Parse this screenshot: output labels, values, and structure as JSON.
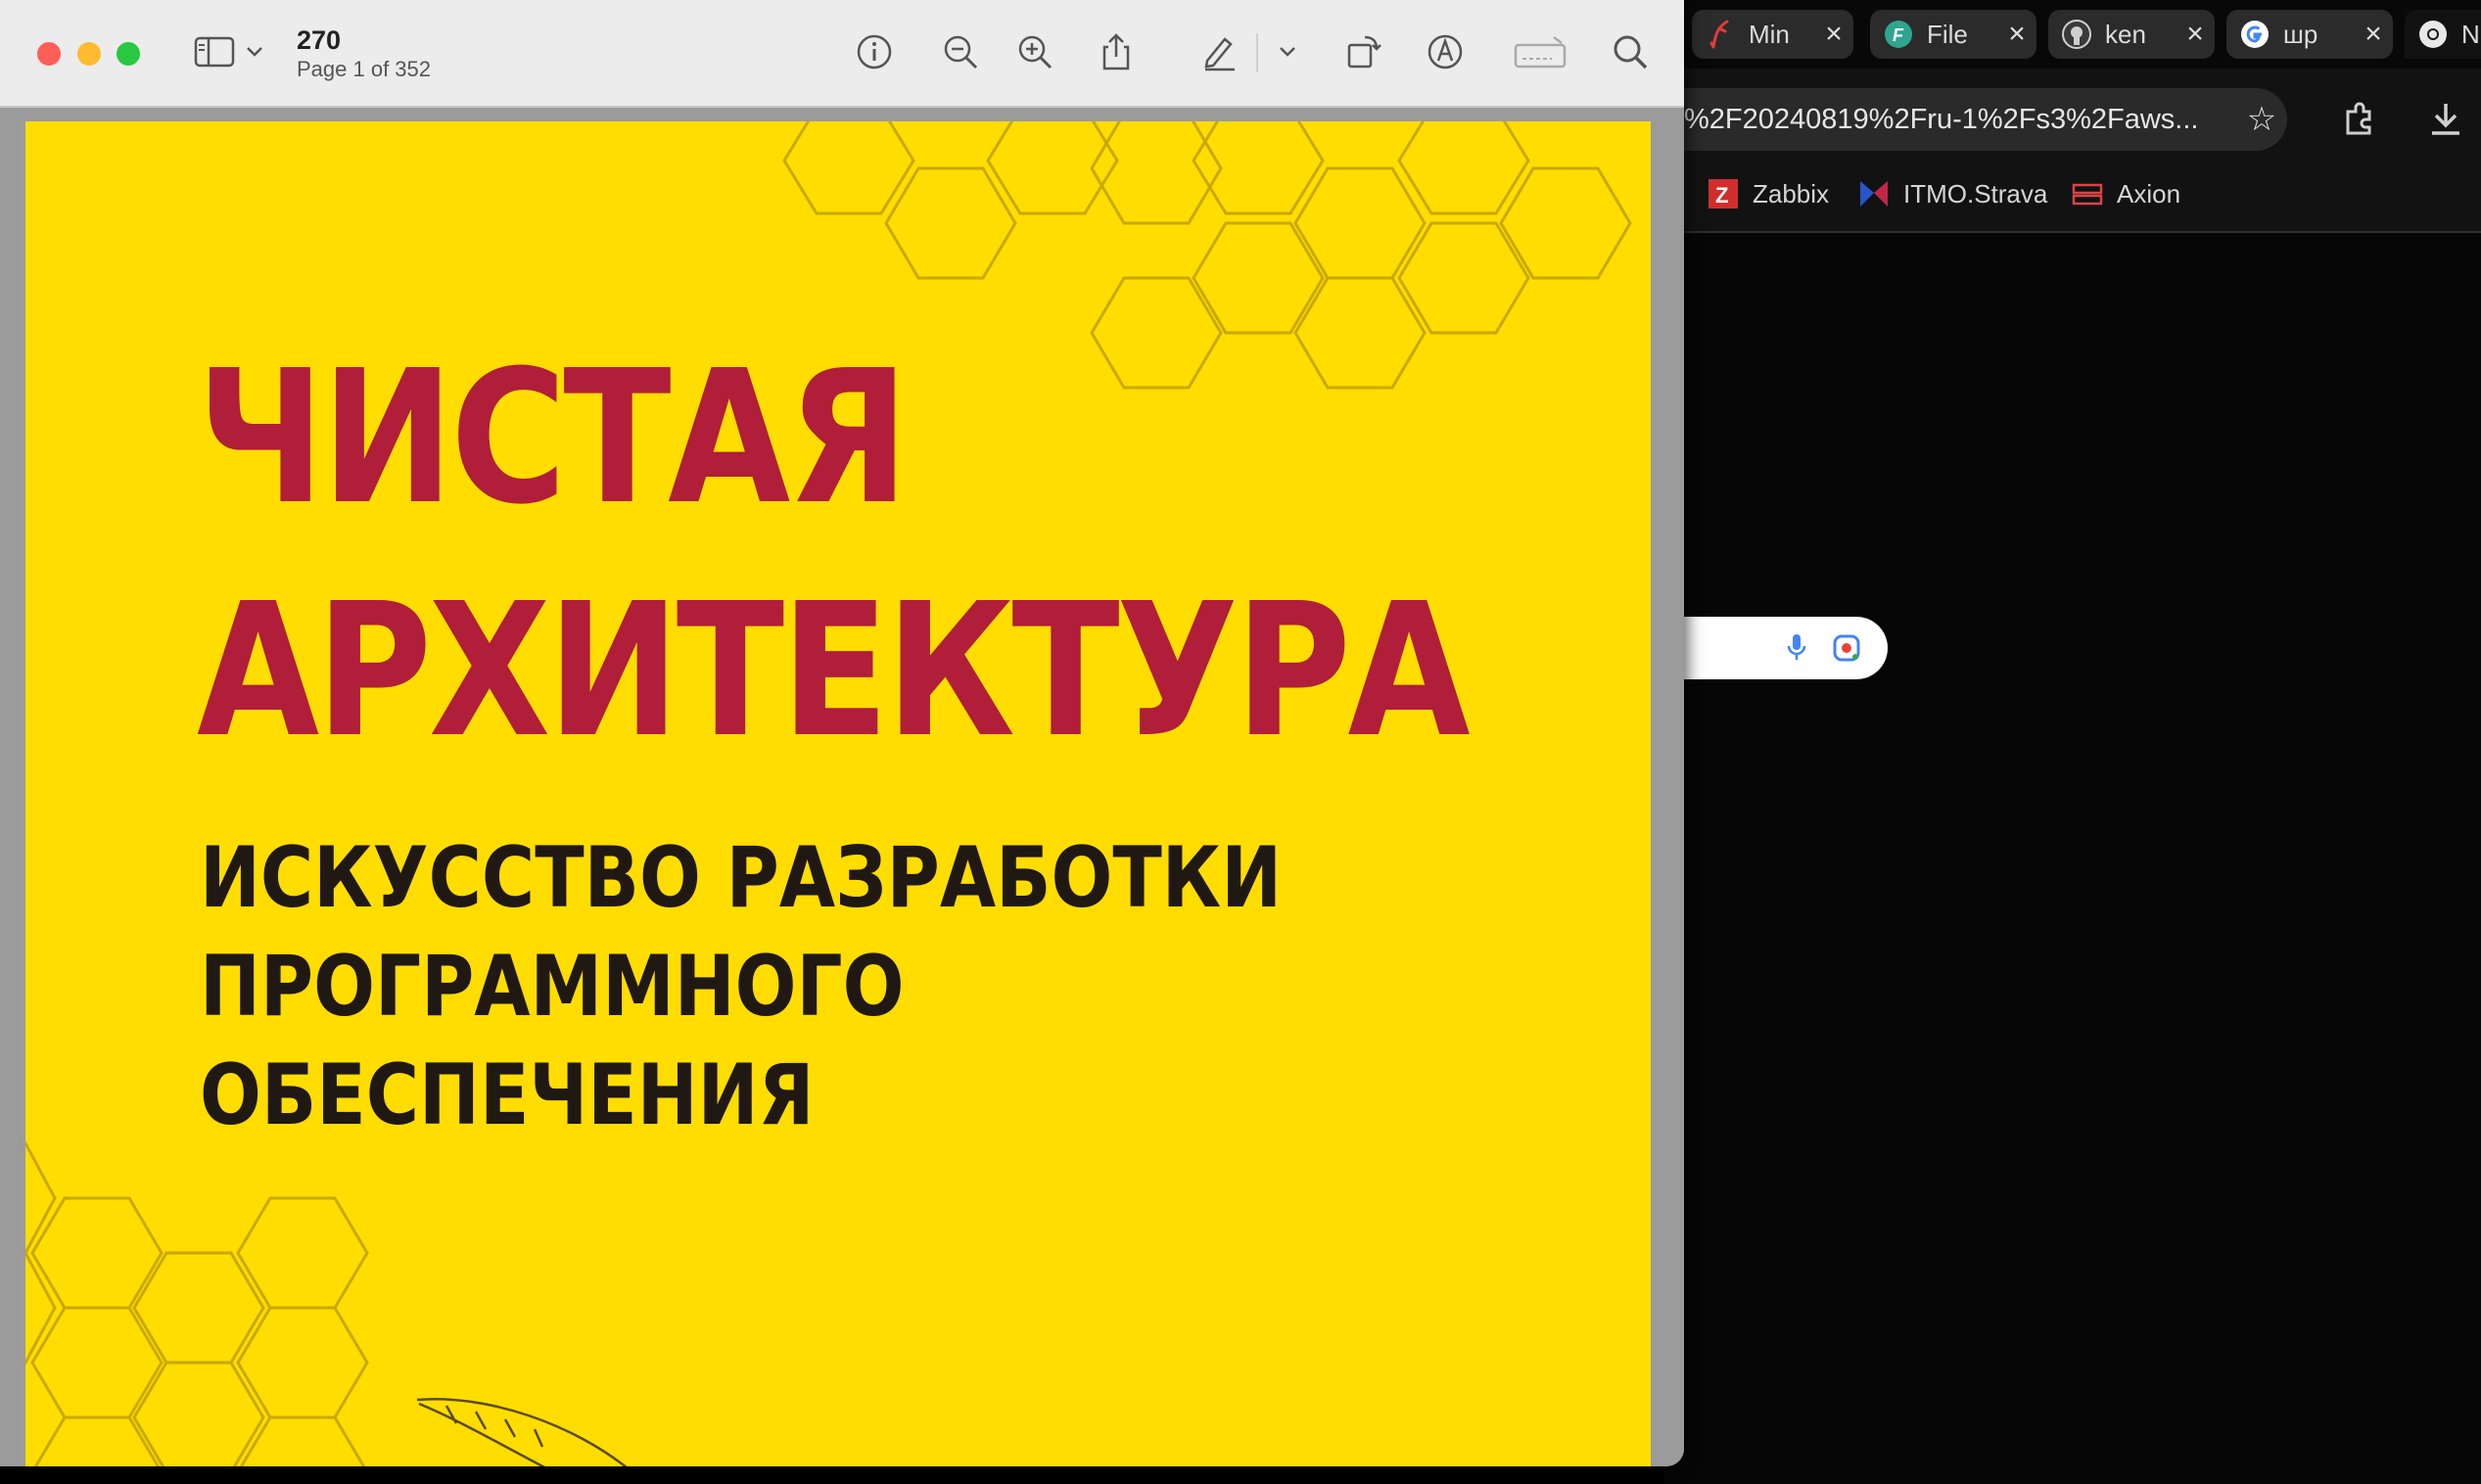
{
  "preview": {
    "doc_title": "270",
    "page_info": "Page 1 of 352",
    "book": {
      "title_line1": "ЧИСТАЯ",
      "title_line2": "АРХИТЕКТУРА",
      "subtitle_line1": "ИСКУССТВО РАЗРАБОТКИ",
      "subtitle_line2": "ПРОГРАММНОГО",
      "subtitle_line3": "ОБЕСПЕЧЕНИЯ"
    },
    "toolbar_icons": [
      "sidebar-icon",
      "chevron-down-icon",
      "info-icon",
      "zoom-out-icon",
      "zoom-in-icon",
      "share-icon",
      "highlight-icon",
      "chevron-down-icon",
      "rotate-icon",
      "markup-icon",
      "signature-icon",
      "search-icon"
    ]
  },
  "chrome": {
    "tabs": [
      {
        "title": "Min",
        "icon": "feather-icon"
      },
      {
        "title": "File",
        "icon": "flutter-f-icon"
      },
      {
        "title": "ken",
        "icon": "github-icon"
      },
      {
        "title": "шр",
        "icon": "google-icon"
      },
      {
        "title": "N",
        "icon": "chrome-icon"
      }
    ],
    "address": "%2F20240819%2Fru-1%2Fs3%2Faws...",
    "bookmarks": [
      "Zabbix",
      "ITMO.Strava",
      "Axion"
    ]
  },
  "colors": {
    "cover_yellow": "#ffdd00",
    "title_red": "#b01e3a",
    "subtitle_dark": "#201812",
    "close_red": "#ff5f57",
    "minimize_yellow": "#febc2e",
    "zoom_green": "#28c840"
  }
}
